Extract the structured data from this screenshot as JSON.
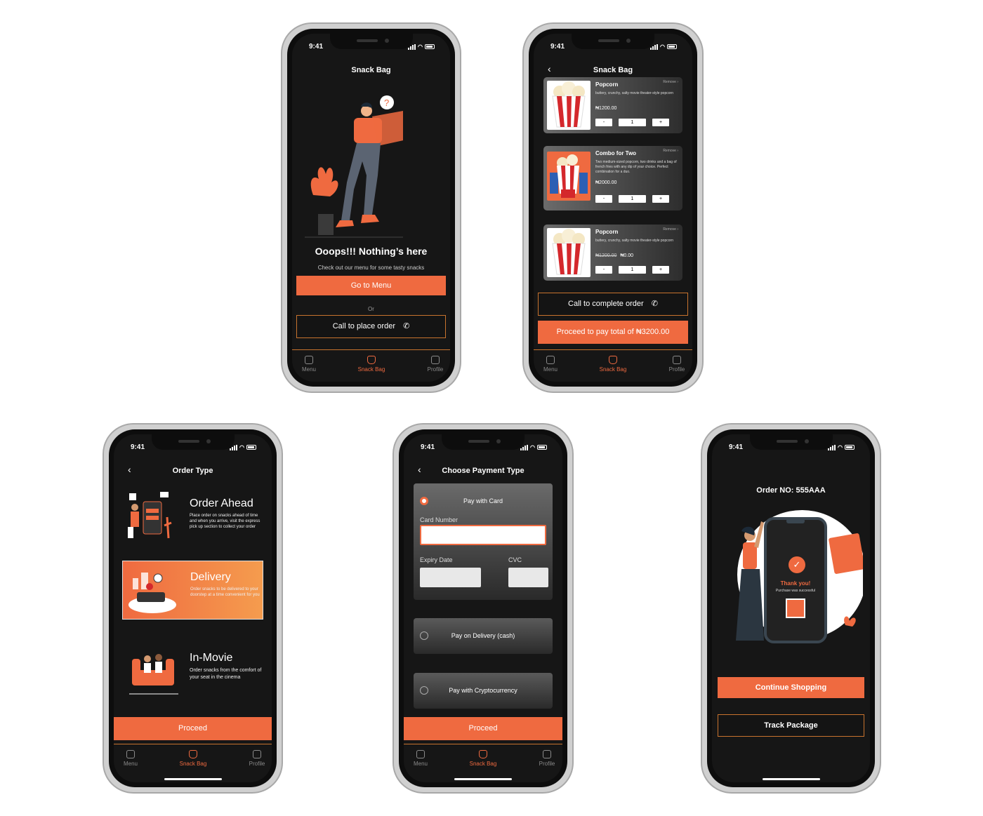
{
  "status_time": "9:41",
  "tabs": {
    "menu": "Menu",
    "snack_bag": "Snack Bag",
    "profile": "Profile"
  },
  "s1": {
    "title": "Snack Bag",
    "heading": "Ooops!!! Nothing’s here",
    "sub": "Check out our menu for some tasty snacks",
    "go_menu": "Go to Menu",
    "or": "Or",
    "call": "Call to place order"
  },
  "s2": {
    "title": "Snack Bag",
    "remove": "Remove",
    "items": [
      {
        "name": "Popcorn",
        "desc": "buttery, crunchy, salty movie theater-style popcorn",
        "price": "₦1200.00",
        "old_price": "",
        "minus": "-",
        "qty": "1",
        "plus": "+"
      },
      {
        "name": "Combo for Two",
        "desc": "Two medium-sized popcorn, two drinks and a bag of french fries with any dip of your choice. Perfect combination for a duo.",
        "price": "₦2000.00",
        "old_price": "",
        "minus": "-",
        "qty": "1",
        "plus": "+"
      },
      {
        "name": "Popcorn",
        "desc": "buttery, crunchy, salty movie theater-style popcorn",
        "price": "₦0.00",
        "old_price": "₦1200.00",
        "minus": "-",
        "qty": "1",
        "plus": "+"
      }
    ],
    "call": "Call to complete order",
    "proceed": "Proceed to pay total of ₦3200.00"
  },
  "s3": {
    "title": "Order Type",
    "options": [
      {
        "head": "Order Ahead",
        "desc": "Place order on snacks ahead of time and when you arrive, visit the express pick up section to collect your order"
      },
      {
        "head": "Delivery",
        "desc": "Order snacks to be delivered to your doorstep at a time convenient for you"
      },
      {
        "head": "In-Movie",
        "desc": "Order snacks from the comfort of your seat in the cinema"
      }
    ],
    "proceed": "Proceed"
  },
  "s4": {
    "title": "Choose Payment Type",
    "card": "Pay with Card",
    "card_number": "Card Number",
    "expiry": "Expiry Date",
    "cvc": "CVC",
    "cash": "Pay on Delivery (cash)",
    "crypto": "Pay with Cryptocurrency",
    "proceed": "Proceed"
  },
  "s5": {
    "order_no": "Order NO: 555AAA",
    "thanks": "Thank you!",
    "thanks_sub": "Purchase was successful",
    "continue": "Continue Shopping",
    "track": "Track Package"
  },
  "colors": {
    "accent": "#ef6a40",
    "outline": "#c8732e",
    "bg": "#161616"
  }
}
